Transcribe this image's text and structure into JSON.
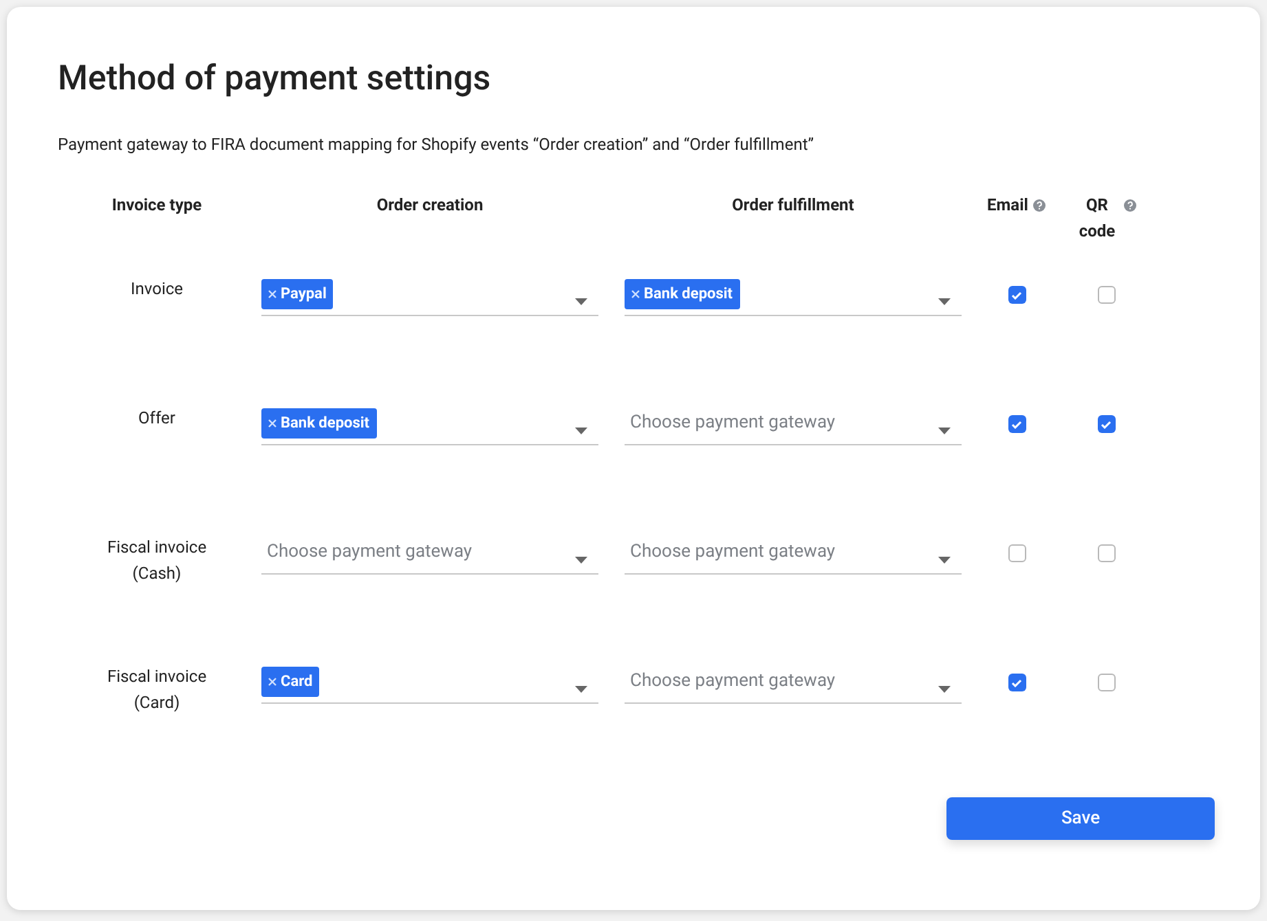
{
  "title": "Method of payment settings",
  "subtitle": "Payment gateway to FIRA document mapping for Shopify events “Order creation” and “Order fulfillment”",
  "columns": [
    {
      "label": "Invoice type",
      "kind": "plain"
    },
    {
      "label": "Order creation",
      "kind": "plain"
    },
    {
      "label": "Order fulfillment",
      "kind": "plain"
    },
    {
      "label": "Email",
      "kind": "help"
    },
    {
      "label": "QR code",
      "kind": "help"
    }
  ],
  "rows": [
    {
      "invoice_type": "Invoice",
      "order_creation": {
        "tags": [
          "Paypal"
        ]
      },
      "order_fulfillment": {
        "tags": [
          "Bank deposit"
        ]
      },
      "email": {
        "checked": true
      },
      "qr_code": {
        "checked": false
      }
    },
    {
      "invoice_type": "Offer",
      "order_creation": {
        "tags": [
          "Bank deposit"
        ]
      },
      "order_fulfillment": {
        "placeholder": "Choose payment gateway"
      },
      "email": {
        "checked": true
      },
      "qr_code": {
        "checked": true
      }
    },
    {
      "invoice_type": "Fiscal invoice (Cash)",
      "order_creation": {
        "placeholder": "Choose payment gateway"
      },
      "order_fulfillment": {
        "placeholder": "Choose payment gateway"
      },
      "email": {
        "checked": false
      },
      "qr_code": {
        "checked": false
      }
    },
    {
      "invoice_type": "Fiscal invoice (Card)",
      "order_creation": {
        "tags": [
          "Card"
        ]
      },
      "order_fulfillment": {
        "placeholder": "Choose payment gateway"
      },
      "email": {
        "checked": true
      },
      "qr_code": {
        "checked": false
      }
    }
  ],
  "save_button": "Save"
}
